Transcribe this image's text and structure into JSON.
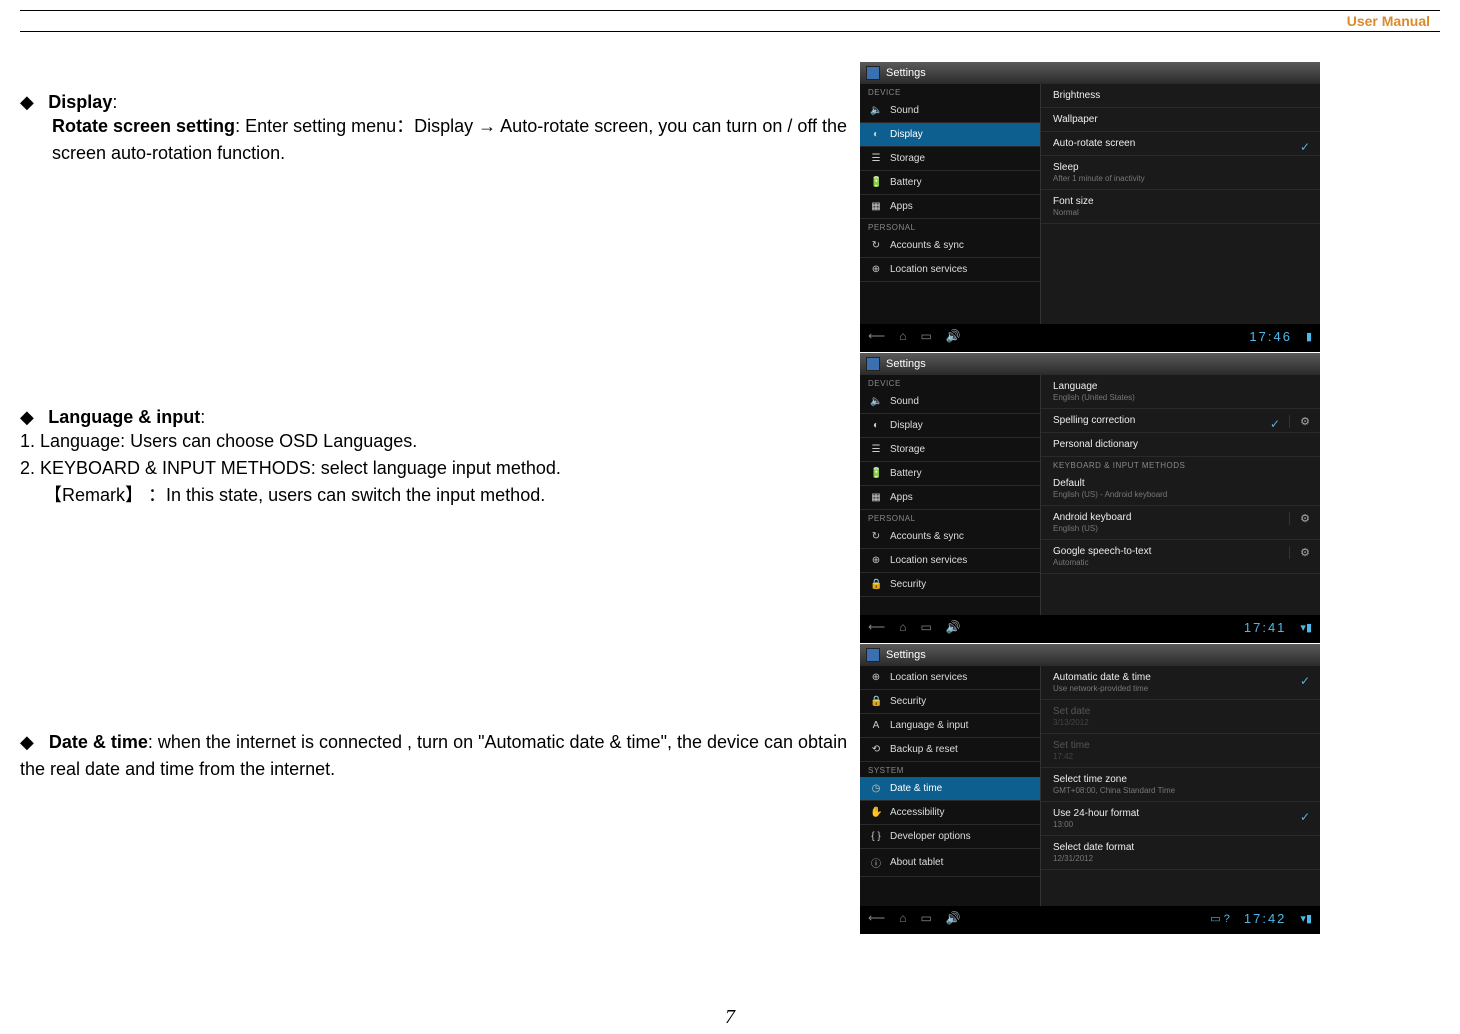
{
  "header": {
    "label": "User Manual"
  },
  "page_number": "7",
  "sections": {
    "display": {
      "title": "Display",
      "sub_bold": "Rotate screen setting",
      "body_part1": ": Enter setting menu：Display ",
      "arrow": "→",
      "body_part2": " Auto-rotate screen, you can turn on / off the screen auto-rotation function."
    },
    "lang": {
      "title": "Language & input",
      "li1_prefix": "1.  ",
      "li1": "Language: Users can choose OSD Languages.",
      "li2_prefix": "2.  ",
      "li2": "KEYBOARD & INPUT METHODS: select language input method.",
      "remark_label": "【Remark】",
      "remark_body": " ：In this state, users can switch the input method."
    },
    "datetime": {
      "title": "Date & time",
      "body": ": when the internet is connected , turn on \"Automatic date & time\", the device can obtain the real date and time from the internet."
    }
  },
  "screens": {
    "s1": {
      "title": "Settings",
      "clock": "17:46",
      "left_cat1": "DEVICE",
      "left_cat2": "PERSONAL",
      "left": [
        "Sound",
        "Display",
        "Storage",
        "Battery",
        "Apps",
        "Accounts & sync",
        "Location services"
      ],
      "selected": "Display",
      "right": [
        {
          "t": "Brightness"
        },
        {
          "t": "Wallpaper"
        },
        {
          "t": "Auto-rotate screen",
          "check": true
        },
        {
          "t": "Sleep",
          "s": "After 1 minute of inactivity"
        },
        {
          "t": "Font size",
          "s": "Normal"
        }
      ]
    },
    "s2": {
      "title": "Settings",
      "clock": "17:41",
      "left_cat1": "DEVICE",
      "left_cat2": "PERSONAL",
      "left": [
        "Sound",
        "Display",
        "Storage",
        "Battery",
        "Apps",
        "Accounts & sync",
        "Location services",
        "Security"
      ],
      "right_cat": "KEYBOARD & INPUT METHODS",
      "right": [
        {
          "t": "Language",
          "s": "English (United States)"
        },
        {
          "t": "Spelling correction",
          "check": true,
          "tune": true
        },
        {
          "t": "Personal dictionary"
        },
        {
          "cat": "KEYBOARD & INPUT METHODS"
        },
        {
          "t": "Default",
          "s": "English (US) - Android keyboard"
        },
        {
          "t": "Android keyboard",
          "s": "English (US)",
          "check": true,
          "tune": true
        },
        {
          "t": "Google speech-to-text",
          "s": "Automatic",
          "tune": true
        }
      ]
    },
    "s3": {
      "title": "Settings",
      "clock": "17:42",
      "left_cat1": "SYSTEM",
      "left": [
        "Location services",
        "Security",
        "Language & input",
        "Backup & reset",
        "Date & time",
        "Accessibility",
        "Developer options",
        "About tablet"
      ],
      "selected": "Date & time",
      "right": [
        {
          "t": "Automatic date & time",
          "s": "Use network-provided time",
          "check": true
        },
        {
          "t": "Set date",
          "s": "3/13/2012",
          "disabled": true
        },
        {
          "t": "Set time",
          "s": "17:42",
          "disabled": true
        },
        {
          "t": "Select time zone",
          "s": "GMT+08:00, China Standard Time"
        },
        {
          "t": "Use 24-hour format",
          "s": "13:00",
          "check": true
        },
        {
          "t": "Select date format",
          "s": "12/31/2012"
        }
      ]
    },
    "nav": {
      "back": "⟵",
      "home": "⌂",
      "recent": "▭",
      "vol": "🔊"
    }
  }
}
